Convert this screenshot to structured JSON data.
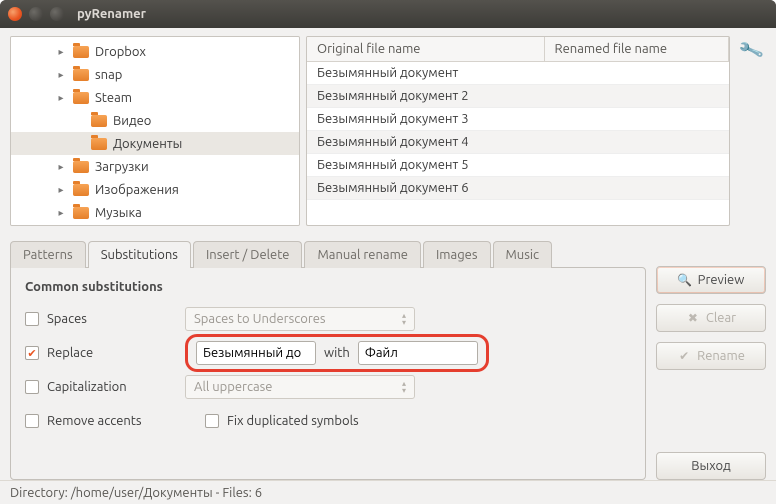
{
  "window": {
    "title": "pyRenamer"
  },
  "tree": {
    "items": [
      {
        "label": "Dropbox",
        "indent": 44,
        "arrow": "▸",
        "selected": false
      },
      {
        "label": "snap",
        "indent": 44,
        "arrow": "▸",
        "selected": false
      },
      {
        "label": "Steam",
        "indent": 44,
        "arrow": "▸",
        "selected": false
      },
      {
        "label": "Видео",
        "indent": 62,
        "arrow": "",
        "selected": false
      },
      {
        "label": "Документы",
        "indent": 62,
        "arrow": "",
        "selected": true
      },
      {
        "label": "Загрузки",
        "indent": 44,
        "arrow": "▸",
        "selected": false
      },
      {
        "label": "Изображения",
        "indent": 44,
        "arrow": "▸",
        "selected": false
      },
      {
        "label": "Музыка",
        "indent": 44,
        "arrow": "▸",
        "selected": false
      }
    ]
  },
  "table": {
    "headers": {
      "original": "Original file name",
      "renamed": "Renamed file name"
    },
    "rows": [
      "Безымянный документ",
      "Безымянный документ 2",
      "Безымянный документ 3",
      "Безымянный документ 4",
      "Безымянный документ 5",
      "Безымянный документ 6"
    ]
  },
  "tabs": {
    "patterns": "Patterns",
    "substitutions": "Substitutions",
    "insert_delete": "Insert / Delete",
    "manual": "Manual rename",
    "images": "Images",
    "music": "Music"
  },
  "subs": {
    "heading": "Common substitutions",
    "spaces_label": "Spaces",
    "spaces_select": "Spaces to Underscores",
    "replace_label": "Replace",
    "replace_from": "Безымянный до",
    "replace_with_label": "with",
    "replace_to": "Файл",
    "capitalization_label": "Capitalization",
    "capitalization_select": "All uppercase",
    "remove_accents_label": "Remove accents",
    "fix_dup_label": "Fix duplicated symbols"
  },
  "buttons": {
    "preview": "Preview",
    "clear": "Clear",
    "rename": "Rename",
    "exit": "Выход"
  },
  "status": "Directory: /home/user/Документы - Files: 6"
}
